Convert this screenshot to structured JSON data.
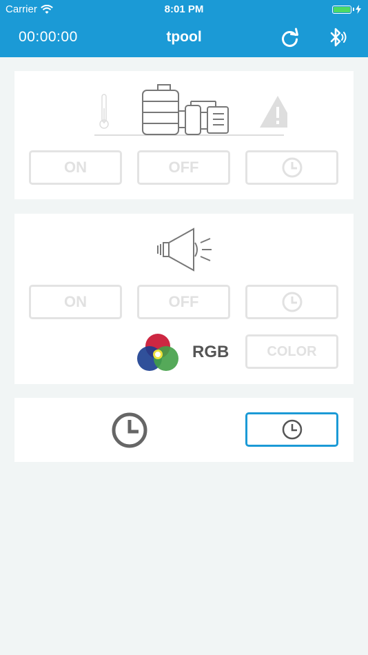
{
  "status_bar": {
    "carrier": "Carrier",
    "time": "8:01 PM"
  },
  "header": {
    "timer": "00:00:00",
    "title": "tpool",
    "refresh_icon": "refresh-icon",
    "bluetooth_icon": "bluetooth-icon",
    "color": "#1b9ad6"
  },
  "pump_panel": {
    "icons": [
      "thermometer-icon",
      "pump-icon",
      "warning-icon"
    ],
    "on_label": "ON",
    "off_label": "OFF",
    "timer_icon": "clock-icon"
  },
  "light_panel": {
    "icon": "pool-light-icon",
    "on_label": "ON",
    "off_label": "OFF",
    "timer_icon": "clock-icon",
    "rgb_label": "RGB",
    "color_label": "COLOR"
  },
  "schedule_panel": {
    "icon": "clock-icon",
    "button_icon": "clock-icon"
  },
  "colors": {
    "background": "#f1f5f5",
    "disabled_border": "#e3e3e3",
    "disabled_text": "#e1e1e1",
    "accent": "#1b9ad6"
  }
}
